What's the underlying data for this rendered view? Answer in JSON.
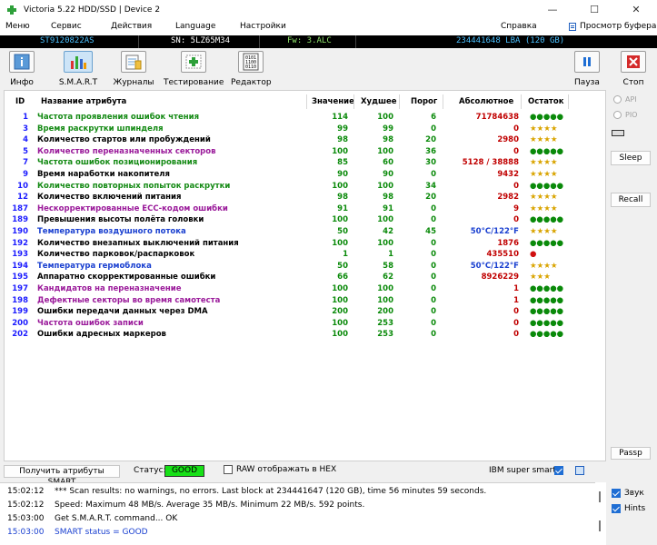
{
  "window": {
    "title": "Victoria 5.22 HDD/SSD | Device 2"
  },
  "menu": {
    "items": [
      "Меню",
      "Сервис",
      "Действия",
      "Language",
      "Настройки",
      "Справка"
    ],
    "clipboard": "Просмотр буфера"
  },
  "drive": {
    "model": "ST9120822AS",
    "serial": "SN: 5LZ65M34",
    "firmware": "Fw: 3.ALC",
    "lba": "234441648 LBA (120 GB)"
  },
  "toolbar": {
    "info": "Инфо",
    "smart": "S.M.A.R.T",
    "logs": "Журналы",
    "testing": "Тестирование",
    "editor": "Редактор",
    "pause": "Пауза",
    "stop": "Стоп"
  },
  "table": {
    "headers": {
      "id": "ID",
      "name": "Название атрибута",
      "value": "Значение",
      "worst": "Худшее",
      "threshold": "Порог",
      "raw": "Абсолютное",
      "remain": "Остаток"
    },
    "rows": [
      {
        "id": "1",
        "name": "Частота проявления ошибок чтения",
        "value": "114",
        "worst": "100",
        "thr": "6",
        "raw": "71784638",
        "rem": "●●●●●",
        "nc": "g",
        "remc": "#0a8a0a"
      },
      {
        "id": "3",
        "name": "Время раскрутки шпинделя",
        "value": "99",
        "worst": "99",
        "thr": "0",
        "raw": "0",
        "rem": "★★★★",
        "nc": "g",
        "remc": "#d9a400"
      },
      {
        "id": "4",
        "name": "Количество стартов или пробуждений",
        "value": "98",
        "worst": "98",
        "thr": "20",
        "raw": "2980",
        "rem": "★★★★",
        "nc": "b",
        "remc": "#d9a400"
      },
      {
        "id": "5",
        "name": "Количество переназначенных секторов",
        "value": "100",
        "worst": "100",
        "thr": "36",
        "raw": "0",
        "rem": "●●●●●",
        "nc": "p",
        "remc": "#0a8a0a"
      },
      {
        "id": "7",
        "name": "Частота ошибок позиционирования",
        "value": "85",
        "worst": "60",
        "thr": "30",
        "raw": "5128 / 38888",
        "rem": "★★★★",
        "nc": "g",
        "remc": "#d9a400"
      },
      {
        "id": "9",
        "name": "Время наработки накопителя",
        "value": "90",
        "worst": "90",
        "thr": "0",
        "raw": "9432",
        "rem": "★★★★",
        "nc": "b",
        "remc": "#d9a400"
      },
      {
        "id": "10",
        "name": "Количество повторных попыток раскрутки",
        "value": "100",
        "worst": "100",
        "thr": "34",
        "raw": "0",
        "rem": "●●●●●",
        "nc": "g",
        "remc": "#0a8a0a"
      },
      {
        "id": "12",
        "name": "Количество включений питания",
        "value": "98",
        "worst": "98",
        "thr": "20",
        "raw": "2982",
        "rem": "★★★★",
        "nc": "b",
        "remc": "#d9a400"
      },
      {
        "id": "187",
        "name": "Нескорректированные ЕСС-кодом ошибки",
        "value": "91",
        "worst": "91",
        "thr": "0",
        "raw": "9",
        "rem": "★★★★",
        "nc": "p",
        "remc": "#d9a400"
      },
      {
        "id": "189",
        "name": "Превышения высоты полёта головки",
        "value": "100",
        "worst": "100",
        "thr": "0",
        "raw": "0",
        "rem": "●●●●●",
        "nc": "b",
        "remc": "#0a8a0a"
      },
      {
        "id": "190",
        "name": "Температура воздушного потока",
        "value": "50",
        "worst": "42",
        "thr": "45",
        "raw": "50°C/122°F",
        "rem": "★★★★",
        "nc": "bl",
        "remc": "#d9a400",
        "rawc": "#1a40d0"
      },
      {
        "id": "192",
        "name": "Количество внезапных выключений питания",
        "value": "100",
        "worst": "100",
        "thr": "0",
        "raw": "1876",
        "rem": "●●●●●",
        "nc": "b",
        "remc": "#0a8a0a"
      },
      {
        "id": "193",
        "name": "Количество парковок/распарковок",
        "value": "1",
        "worst": "1",
        "thr": "0",
        "raw": "435510",
        "rem": "●",
        "nc": "b",
        "remc": "#d01010"
      },
      {
        "id": "194",
        "name": "Температура гермоблока",
        "value": "50",
        "worst": "58",
        "thr": "0",
        "raw": "50°C/122°F",
        "rem": "★★★★",
        "nc": "bl",
        "remc": "#d9a400",
        "rawc": "#1a40d0"
      },
      {
        "id": "195",
        "name": "Аппаратно скорректированные ошибки",
        "value": "66",
        "worst": "62",
        "thr": "0",
        "raw": "8926229",
        "rem": "★★★",
        "nc": "b",
        "remc": "#d9a400"
      },
      {
        "id": "197",
        "name": "Кандидатов на переназначение",
        "value": "100",
        "worst": "100",
        "thr": "0",
        "raw": "1",
        "rem": "●●●●●",
        "nc": "p",
        "remc": "#0a8a0a"
      },
      {
        "id": "198",
        "name": "Дефектные секторы во время самотеста",
        "value": "100",
        "worst": "100",
        "thr": "0",
        "raw": "1",
        "rem": "●●●●●",
        "nc": "p",
        "remc": "#0a8a0a"
      },
      {
        "id": "199",
        "name": "Ошибки передачи данных через DMA",
        "value": "200",
        "worst": "200",
        "thr": "0",
        "raw": "0",
        "rem": "●●●●●",
        "nc": "b",
        "remc": "#0a8a0a"
      },
      {
        "id": "200",
        "name": "Частота ошибок записи",
        "value": "100",
        "worst": "253",
        "thr": "0",
        "raw": "0",
        "rem": "●●●●●",
        "nc": "p",
        "remc": "#0a8a0a"
      },
      {
        "id": "202",
        "name": "Ошибки адресных маркеров",
        "value": "100",
        "worst": "253",
        "thr": "0",
        "raw": "0",
        "rem": "●●●●●",
        "nc": "b",
        "remc": "#0a8a0a"
      }
    ]
  },
  "side": {
    "api": "API",
    "pio": "PIO",
    "sleep": "Sleep",
    "recall": "Recall",
    "passp": "Passp"
  },
  "status": {
    "get_smart": "Получить атрибуты SMART",
    "label": "Статус:",
    "value": "GOOD",
    "raw_hex": "RAW отображать в HEX",
    "ibm": "IBM super smart:"
  },
  "log": [
    {
      "ts": "15:02:12",
      "text": "*** Scan results: no warnings, no errors. Last block at 234441647 (120 GB), time 56 minutes 59 seconds.",
      "c": "#000"
    },
    {
      "ts": "15:02:12",
      "text": "Speed: Maximum 48 MB/s. Average 35 MB/s. Minimum 22 MB/s. 592 points.",
      "c": "#000"
    },
    {
      "ts": "15:03:00",
      "text": "Get S.M.A.R.T. command... OK",
      "c": "#000"
    },
    {
      "ts": "15:03:00",
      "text": "SMART status = GOOD",
      "c": "#1a40d0"
    }
  ],
  "options": {
    "sound": "Звук",
    "hints": "Hints"
  }
}
